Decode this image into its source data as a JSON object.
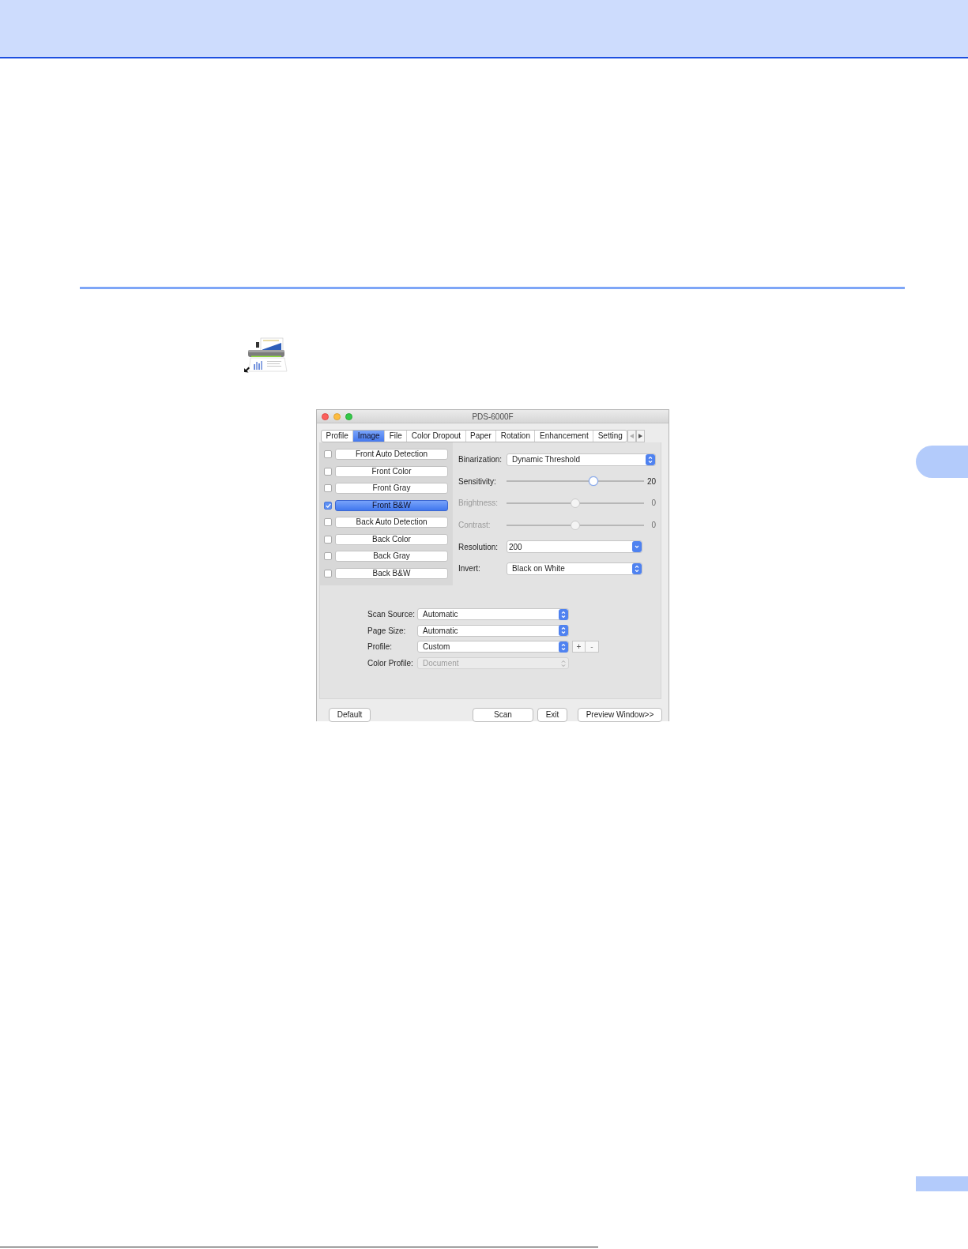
{
  "window": {
    "title": "PDS-6000F"
  },
  "tabs": [
    {
      "label": "Profile",
      "selected": false
    },
    {
      "label": "Image",
      "selected": true
    },
    {
      "label": "File",
      "selected": false
    },
    {
      "label": "Color Dropout",
      "selected": false
    },
    {
      "label": "Paper",
      "selected": false
    },
    {
      "label": "Rotation",
      "selected": false
    },
    {
      "label": "Enhancement",
      "selected": false
    },
    {
      "label": "Setting",
      "selected": false
    }
  ],
  "image_options": {
    "front": [
      {
        "label": "Front Auto Detection",
        "checked": false,
        "selected": false
      },
      {
        "label": "Front Color",
        "checked": false,
        "selected": false
      },
      {
        "label": "Front Gray",
        "checked": false,
        "selected": false
      },
      {
        "label": "Front B&W",
        "checked": true,
        "selected": true
      }
    ],
    "back": [
      {
        "label": "Back Auto Detection",
        "checked": false,
        "selected": false
      },
      {
        "label": "Back Color",
        "checked": false,
        "selected": false
      },
      {
        "label": "Back Gray",
        "checked": false,
        "selected": false
      },
      {
        "label": "Back B&W",
        "checked": false,
        "selected": false
      }
    ]
  },
  "settings": [
    {
      "kind": "popup",
      "label": "Binarization:",
      "value": "Dynamic Threshold",
      "disabled": false
    },
    {
      "kind": "slider",
      "label": "Sensitivity:",
      "level": 0.64,
      "reading": "20",
      "disabled": false
    },
    {
      "kind": "slider",
      "label": "Brightness:",
      "level": 0.5,
      "reading": "0",
      "disabled": true
    },
    {
      "kind": "slider",
      "label": "Contrast:",
      "level": 0.5,
      "reading": "0",
      "disabled": true
    },
    {
      "kind": "combo",
      "label": "Resolution:",
      "value": "200",
      "disabled": false
    },
    {
      "kind": "popup",
      "label": "Invert:",
      "value": "Black on White",
      "disabled": false
    }
  ],
  "source_settings": [
    {
      "label": "Scan Source:",
      "value": "Automatic",
      "disabled": false
    },
    {
      "label": "Page Size:",
      "value": "Automatic",
      "disabled": false
    },
    {
      "label": "Profile:",
      "value": "Custom",
      "disabled": false,
      "add": "+",
      "remove": "-"
    },
    {
      "label": "Color Profile:",
      "value": "Document",
      "disabled": true
    }
  ],
  "left_buttons": [
    "Default"
  ],
  "right_buttons": [
    "Scan",
    "Exit",
    "Preview Window>>"
  ]
}
